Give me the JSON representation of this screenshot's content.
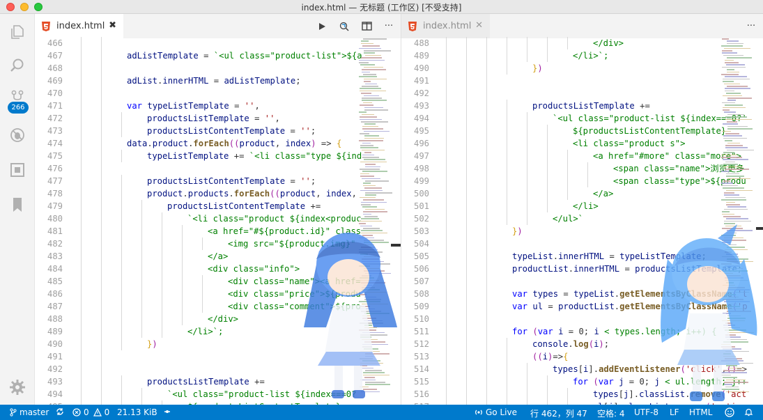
{
  "window": {
    "title": "index.html — 无标题 (工作区) [不受支持]"
  },
  "activity_bar": {
    "items": [
      {
        "icon": "files-icon"
      },
      {
        "icon": "search-icon"
      },
      {
        "icon": "source-control-icon"
      },
      {
        "icon": "debug-icon"
      },
      {
        "icon": "extensions-icon"
      },
      {
        "icon": "bookmark-icon"
      }
    ],
    "scm_badge": "266",
    "settings_icon": "gear-icon"
  },
  "left_editor": {
    "tab": {
      "label": "index.html",
      "close": "✖",
      "active": true
    },
    "actions": [
      "run-icon",
      "compare-icon",
      "split-editor-icon",
      "more-icon"
    ],
    "more_label": "···",
    "lines": [
      {
        "n": "466",
        "code": ""
      },
      {
        "n": "467",
        "code": "adListTemplate = `<ul class=\"product-list\">${a"
      },
      {
        "n": "468",
        "code": ""
      },
      {
        "n": "469",
        "code": "adList.innerHTML = adListTemplate;"
      },
      {
        "n": "470",
        "code": ""
      },
      {
        "n": "471",
        "code": "var typeListTemplate = '',",
        "indent": 1
      },
      {
        "n": "472",
        "code": "productsListTemplate = '',",
        "indent": 2
      },
      {
        "n": "473",
        "code": "productsListContentTemplate = '';",
        "indent": 2
      },
      {
        "n": "474",
        "code": "data.product.forEach((product, index) => {",
        "indent": 1
      },
      {
        "n": "475",
        "code": "typeListTemplate += `<li class=\"type ${ind",
        "indent": 2
      },
      {
        "n": "476",
        "code": ""
      },
      {
        "n": "477",
        "code": "productsListContentTemplate = '';",
        "indent": 2
      },
      {
        "n": "478",
        "code": "product.products.forEach((product, index,",
        "indent": 2
      },
      {
        "n": "479",
        "code": "productsListContentTemplate +=",
        "indent": 3
      },
      {
        "n": "480",
        "code": "`<li class=\"product ${index<produc",
        "indent": 4
      },
      {
        "n": "481",
        "code": "<a href=\"#${product.id}\" class",
        "indent": 5
      },
      {
        "n": "482",
        "code": "<img src=\"${product.img}\"",
        "indent": 6
      },
      {
        "n": "483",
        "code": "</a>",
        "indent": 5
      },
      {
        "n": "484",
        "code": "<div class=\"info\">",
        "indent": 5
      },
      {
        "n": "485",
        "code": "<div class=\"name\"><a href=",
        "indent": 6
      },
      {
        "n": "486",
        "code": "<div class=\"price\">${produ",
        "indent": 6
      },
      {
        "n": "487",
        "code": "<div class=\"comment\">${pro",
        "indent": 6
      },
      {
        "n": "488",
        "code": "</div>",
        "indent": 5
      },
      {
        "n": "489",
        "code": "</li>`;",
        "indent": 4
      },
      {
        "n": "490",
        "code": "})",
        "indent": 2
      },
      {
        "n": "491",
        "code": ""
      },
      {
        "n": "492",
        "code": ""
      },
      {
        "n": "493",
        "code": "productsListTemplate +=",
        "indent": 2
      },
      {
        "n": "494",
        "code": "`<ul class=\"product-list ${index===0?",
        "indent": 3
      },
      {
        "n": "495",
        "code": "${productsListContentTemplate}",
        "indent": 4
      }
    ]
  },
  "right_editor": {
    "tab": {
      "label": "index.html",
      "close": "✕",
      "active": false
    },
    "actions": [
      "more-icon"
    ],
    "more_label": "···",
    "lines": [
      {
        "n": "488",
        "code": "</div>",
        "indent": 7
      },
      {
        "n": "489",
        "code": "</li>`;",
        "indent": 6
      },
      {
        "n": "490",
        "code": "})",
        "indent": 4
      },
      {
        "n": "491",
        "code": ""
      },
      {
        "n": "492",
        "code": ""
      },
      {
        "n": "493",
        "code": "productsListTemplate +=",
        "indent": 4
      },
      {
        "n": "494",
        "code": "`<ul class=\"product-list ${index===0?'",
        "indent": 5
      },
      {
        "n": "495",
        "code": "${productsListContentTemplate}",
        "indent": 6
      },
      {
        "n": "496",
        "code": "<li class=\"product s\">",
        "indent": 6
      },
      {
        "n": "497",
        "code": "<a href=\"#more\" class=\"more\">",
        "indent": 7
      },
      {
        "n": "498",
        "code": "<span class=\"name\">浏览更多",
        "indent": 8
      },
      {
        "n": "499",
        "code": "<span class=\"type\">${produ",
        "indent": 8
      },
      {
        "n": "500",
        "code": "</a>",
        "indent": 7
      },
      {
        "n": "501",
        "code": "</li>",
        "indent": 6
      },
      {
        "n": "502",
        "code": "</ul>`",
        "indent": 5
      },
      {
        "n": "503",
        "code": "})",
        "indent": 3
      },
      {
        "n": "504",
        "code": ""
      },
      {
        "n": "505",
        "code": "typeList.innerHTML = typeListTemplate;",
        "indent": 3
      },
      {
        "n": "506",
        "code": "productList.innerHTML = productsListTemplate;",
        "indent": 3
      },
      {
        "n": "507",
        "code": ""
      },
      {
        "n": "508",
        "code": "var types = typeList.getElementsByClassName('t",
        "indent": 3
      },
      {
        "n": "509",
        "code": "var ul = productList.getElementsByClassName('p",
        "indent": 3
      },
      {
        "n": "510",
        "code": ""
      },
      {
        "n": "511",
        "code": "for (var i = 0; i < types.length; i++) {",
        "indent": 3
      },
      {
        "n": "512",
        "code": "console.log(i);",
        "indent": 4
      },
      {
        "n": "513",
        "code": "((i)=>{",
        "indent": 4
      },
      {
        "n": "514",
        "code": "types[i].addEventListener('click',()=>",
        "indent": 5
      },
      {
        "n": "515",
        "code": "for (var j = 0; j < ul.length; j++",
        "indent": 6
      },
      {
        "n": "516",
        "code": "types[j].classList.remove('act",
        "indent": 7
      },
      {
        "n": "517",
        "code": "ul[j].classList.remove('active",
        "indent": 7
      }
    ]
  },
  "status_bar": {
    "branch": "master",
    "errors": "0",
    "warnings": "0",
    "file_size": "21.13 KiB",
    "go_live": "Go Live",
    "cursor": "行 462，列 47",
    "indent": "空格: 4",
    "encoding": "UTF-8",
    "eol": "LF",
    "language": "HTML"
  },
  "colors": {
    "accent": "#007acc",
    "keyword": "#0000ff",
    "template": "#008000",
    "function": "#795e26",
    "string": "#a31515"
  }
}
